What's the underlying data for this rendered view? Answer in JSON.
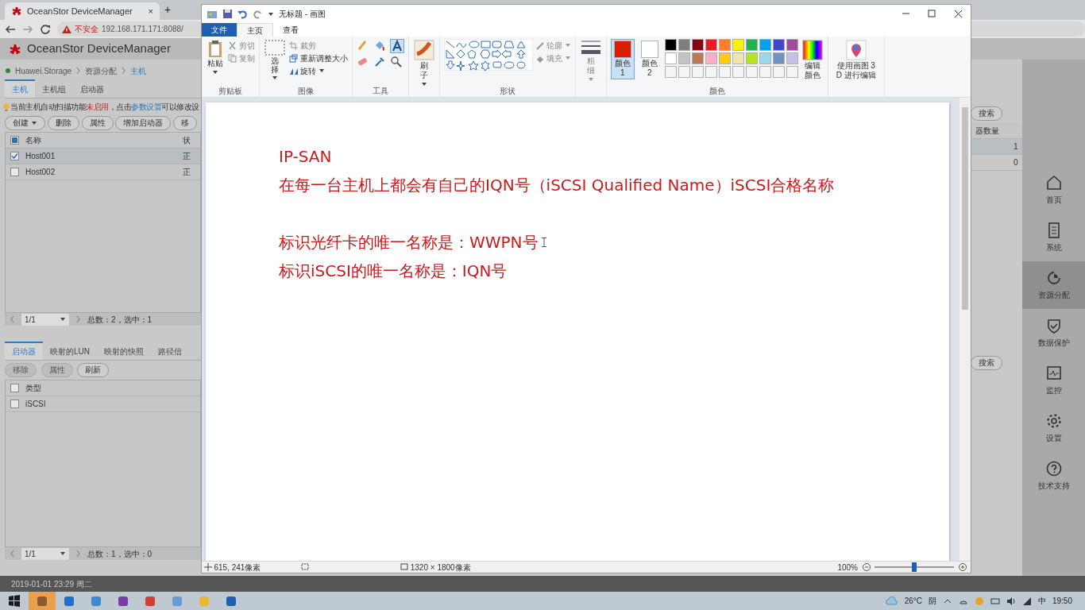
{
  "browser": {
    "tab_title": "OceanStor DeviceManager",
    "tab_close": "×",
    "new_tab": "+",
    "security": "不安全",
    "url": "192.168.171.171:8088/"
  },
  "app": {
    "title": "OceanStor DeviceManager",
    "breadcrumb": [
      "Huawei.Storage",
      "资源分配",
      "主机"
    ],
    "host_tabs": [
      {
        "label": "主机",
        "selected": true
      },
      {
        "label": "主机组",
        "selected": false
      },
      {
        "label": "启动器",
        "selected": false
      }
    ],
    "notice": {
      "prefix": "当前主机自动扫描功能",
      "status": "未启用",
      "middle": "，点击",
      "link": "参数设置",
      "suffix": "可以修改设"
    },
    "host_buttons": [
      {
        "label": "创建",
        "dropdown": true
      },
      {
        "label": "删除",
        "dropdown": false
      },
      {
        "label": "属性",
        "dropdown": false
      },
      {
        "label": "增加启动器",
        "dropdown": false
      },
      {
        "label": "移",
        "dropdown": false
      }
    ],
    "host_table": {
      "select_all": true,
      "columns": [
        "名称",
        "状"
      ],
      "rows": [
        {
          "name": "Host001",
          "status": "正",
          "checked": true
        },
        {
          "name": "Host002",
          "status": "正",
          "checked": false
        }
      ]
    },
    "host_pager": {
      "page": "1/1",
      "summary": "总数：2，选中：1"
    },
    "host_right": {
      "search": "搜索",
      "column": "器数量",
      "values": [
        "1",
        "0"
      ]
    },
    "detail_tabs": [
      {
        "label": "启动器",
        "selected": true
      },
      {
        "label": "映射的LUN",
        "selected": false
      },
      {
        "label": "映射的快照",
        "selected": false
      },
      {
        "label": "路径信",
        "selected": false
      }
    ],
    "detail_buttons": [
      {
        "label": "移除",
        "disabled": true
      },
      {
        "label": "属性",
        "disabled": true
      },
      {
        "label": "刷新",
        "disabled": false
      }
    ],
    "detail_table": {
      "select_all": false,
      "columns": [
        "类型"
      ],
      "rows": [
        {
          "type": "iSCSI",
          "checked": false
        }
      ]
    },
    "detail_search": "搜索",
    "detail_pager": {
      "page": "1/1",
      "summary": "总数：1，选中：0"
    },
    "nav": [
      {
        "label": "首页",
        "selected": false
      },
      {
        "label": "系统",
        "selected": false
      },
      {
        "label": "资源分配",
        "selected": true
      },
      {
        "label": "数据保护",
        "selected": false
      },
      {
        "label": "监控",
        "selected": false
      },
      {
        "label": "设置",
        "selected": false
      },
      {
        "label": "技术支持",
        "selected": false
      }
    ],
    "status": "2019-01-01 23:29 周二"
  },
  "paint": {
    "title": "无标题 - 画图",
    "tabs": [
      {
        "label": "文件",
        "kind": "file"
      },
      {
        "label": "主页",
        "kind": "tab",
        "selected": true
      },
      {
        "label": "查看",
        "kind": "tab",
        "selected": false
      }
    ],
    "clipboard": {
      "paste": "粘贴",
      "cut": {
        "label": "剪切",
        "disabled": true
      },
      "copy": {
        "label": "复制",
        "disabled": true
      },
      "group": "剪贴板"
    },
    "image": {
      "select": "选择",
      "crop": {
        "label": "裁剪",
        "disabled": true
      },
      "resize": "重新调整大小",
      "rotate": "旋转",
      "group": "图像"
    },
    "tools": {
      "group": "工具",
      "text_selected": true
    },
    "brush": "刷子",
    "shapes": {
      "outline": {
        "label": "轮廓",
        "disabled": true
      },
      "fill": {
        "label": "填充",
        "disabled": true
      },
      "group": "形状"
    },
    "size": {
      "label": "粗细",
      "disabled": true
    },
    "color1": {
      "label": "颜色 1",
      "color": "#d81e06",
      "selected": true
    },
    "color2": {
      "label": "颜色 2",
      "color": "#ffffff",
      "selected": false
    },
    "palette": [
      {
        "color": "#000000"
      },
      {
        "color": "#7f7f7f"
      },
      {
        "color": "#880015"
      },
      {
        "color": "#ed1c24"
      },
      {
        "color": "#ff7f27"
      },
      {
        "color": "#fff200"
      },
      {
        "color": "#22b14c"
      },
      {
        "color": "#00a2e8"
      },
      {
        "color": "#3f48cc"
      },
      {
        "color": "#a349a4"
      },
      {
        "color": "#ffffff"
      },
      {
        "color": "#c3c3c3"
      },
      {
        "color": "#b97a57"
      },
      {
        "color": "#ffaec9"
      },
      {
        "color": "#ffc90e"
      },
      {
        "color": "#efe4b0"
      },
      {
        "color": "#b5e61d"
      },
      {
        "color": "#99d9ea"
      },
      {
        "color": "#7092be"
      },
      {
        "color": "#c8bfe7"
      }
    ],
    "edit_colors": "编辑颜色",
    "paint3d": "使用画图 3 D 进行编辑",
    "colors_group": "颜色",
    "canvas_lines": [
      "IP-SAN",
      "在每一台主机上都会有自己的IQN号（iSCSI Qualified Name）iSCSI合格名称",
      "标识光纤卡的唯一名称是：WWPN号",
      "标识iSCSI的唯一名称是：IQN号"
    ],
    "status": {
      "cursor": "615, 241像素",
      "size": "1320 × 1800像素",
      "zoom": "100%",
      "level": 0.5
    }
  },
  "taskbar": {
    "apps": [
      {
        "active": true
      },
      {
        "active": false
      },
      {
        "active": false
      },
      {
        "active": false
      },
      {
        "active": false
      },
      {
        "active": false
      },
      {
        "active": false
      },
      {
        "active": false
      }
    ],
    "weather": "26°C",
    "condition": "阴",
    "ime": "中",
    "time": "19:50"
  }
}
